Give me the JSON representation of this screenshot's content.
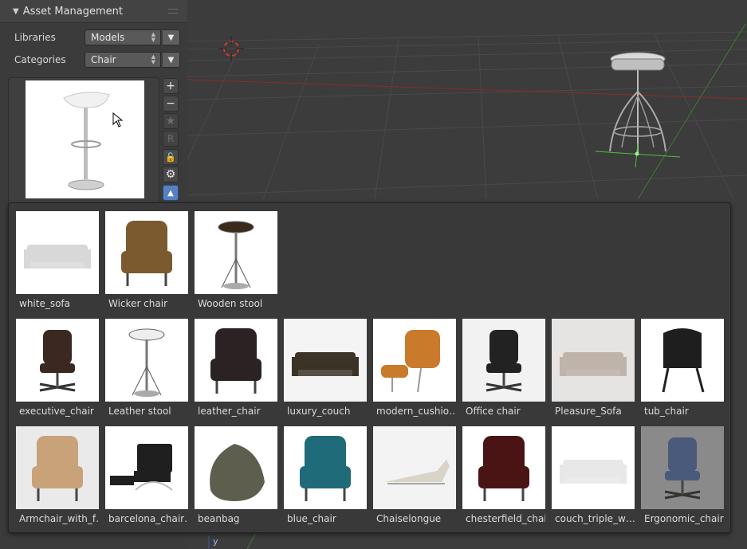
{
  "panel": {
    "title": "Asset Management",
    "libraries_label": "Libraries",
    "libraries_value": "Models",
    "categories_label": "Categories",
    "categories_value": "Chair"
  },
  "toolbar_icons": [
    "plus-icon",
    "minus-icon",
    "star-icon",
    "r-icon",
    "lock-icon",
    "gear-icon",
    "chevron-up-icon"
  ],
  "viewport": {
    "axis_label": "y"
  },
  "assets": [
    {
      "name": "white_sofa"
    },
    {
      "name": "Wicker chair"
    },
    {
      "name": "Wooden stool"
    },
    {
      "name": "executive_chair"
    },
    {
      "name": "Leather stool"
    },
    {
      "name": "leather_chair"
    },
    {
      "name": "luxury_couch"
    },
    {
      "name": "modern_cushio…"
    },
    {
      "name": "Office chair"
    },
    {
      "name": "Pleasure_Sofa"
    },
    {
      "name": "tub_chair"
    },
    {
      "name": "Armchair_with_f…"
    },
    {
      "name": "barcelona_chair…"
    },
    {
      "name": "beanbag"
    },
    {
      "name": "blue_chair"
    },
    {
      "name": "Chaiselongue"
    },
    {
      "name": "chesterfield_chair"
    },
    {
      "name": "couch_triple_w…"
    },
    {
      "name": "Ergonomic_chair"
    }
  ]
}
